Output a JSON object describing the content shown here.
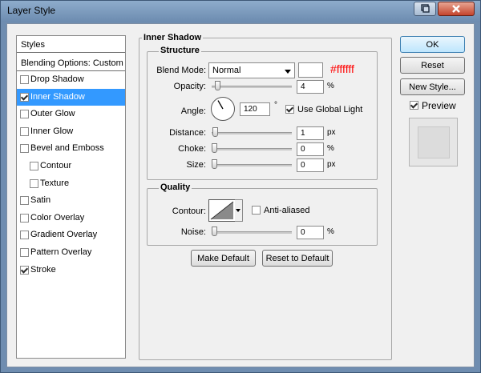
{
  "window": {
    "title": "Layer Style"
  },
  "styles_panel": {
    "header": "Styles",
    "blending_options": "Blending Options: Custom",
    "items": [
      {
        "label": "Drop Shadow",
        "checked": false,
        "sub": false,
        "selected": false
      },
      {
        "label": "Inner Shadow",
        "checked": true,
        "sub": false,
        "selected": true
      },
      {
        "label": "Outer Glow",
        "checked": false,
        "sub": false,
        "selected": false
      },
      {
        "label": "Inner Glow",
        "checked": false,
        "sub": false,
        "selected": false
      },
      {
        "label": "Bevel and Emboss",
        "checked": false,
        "sub": false,
        "selected": false
      },
      {
        "label": "Contour",
        "checked": false,
        "sub": true,
        "selected": false
      },
      {
        "label": "Texture",
        "checked": false,
        "sub": true,
        "selected": false
      },
      {
        "label": "Satin",
        "checked": false,
        "sub": false,
        "selected": false
      },
      {
        "label": "Color Overlay",
        "checked": false,
        "sub": false,
        "selected": false
      },
      {
        "label": "Gradient Overlay",
        "checked": false,
        "sub": false,
        "selected": false
      },
      {
        "label": "Pattern Overlay",
        "checked": false,
        "sub": false,
        "selected": false
      },
      {
        "label": "Stroke",
        "checked": true,
        "sub": false,
        "selected": false
      }
    ]
  },
  "inner_shadow": {
    "title": "Inner Shadow",
    "structure": {
      "title": "Structure",
      "blend_mode_label": "Blend Mode:",
      "blend_mode_value": "Normal",
      "color_hex": "#ffffff",
      "opacity_label": "Opacity:",
      "opacity_value": "4",
      "opacity_fraction": 0.04,
      "opacity_unit": "%",
      "angle_label": "Angle:",
      "angle_value": "120",
      "angle_unit": "°",
      "use_global_light_label": "Use Global Light",
      "use_global_light": true,
      "distance_label": "Distance:",
      "distance_value": "1",
      "distance_unit": "px",
      "choke_label": "Choke:",
      "choke_value": "0",
      "choke_unit": "%",
      "size_label": "Size:",
      "size_value": "0",
      "size_unit": "px"
    },
    "quality": {
      "title": "Quality",
      "contour_label": "Contour:",
      "anti_aliased_label": "Anti-aliased",
      "anti_aliased": false,
      "noise_label": "Noise:",
      "noise_value": "0",
      "noise_unit": "%"
    },
    "make_default_label": "Make Default",
    "reset_default_label": "Reset to Default"
  },
  "side_buttons": {
    "ok_label": "OK",
    "reset_label": "Reset",
    "new_style_label": "New Style...",
    "preview_label": "Preview",
    "preview_checked": true
  },
  "colors": {
    "selection": "#3399ff",
    "hex_text": "#ff0000",
    "title_bar": "#7d9bbd"
  }
}
